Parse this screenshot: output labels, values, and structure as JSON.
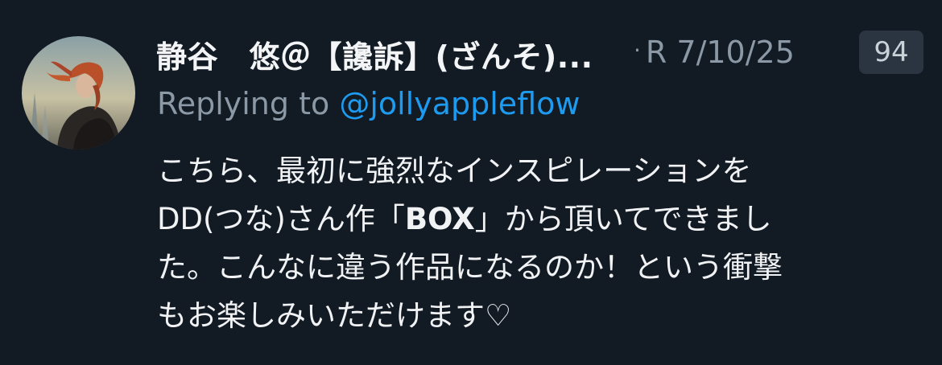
{
  "post": {
    "display_name": "静谷　悠＠【讒訴】(ざんそ)...",
    "dot": "·",
    "meta": "R 7/10/25",
    "count": "94",
    "reply_prefix": "Replying to ",
    "reply_handle": "@jollyappleflow",
    "body": {
      "line1": "こちら、最初に強烈なインスピレーションを",
      "line2_a": "DD(つな)さん作「",
      "line2_bold": "BOX",
      "line2_b": "」から頂いてできまし",
      "line3": "た。こんなに違う作品になるのか！という衝撃",
      "line4": "もお楽しみいただけます♡"
    }
  },
  "colors": {
    "background": "#121a24",
    "text": "#f0f2f4",
    "muted": "#8b98a5",
    "link": "#1d9bf0",
    "badge_bg": "#2a3541"
  },
  "icons": {
    "avatar": "user-avatar"
  }
}
